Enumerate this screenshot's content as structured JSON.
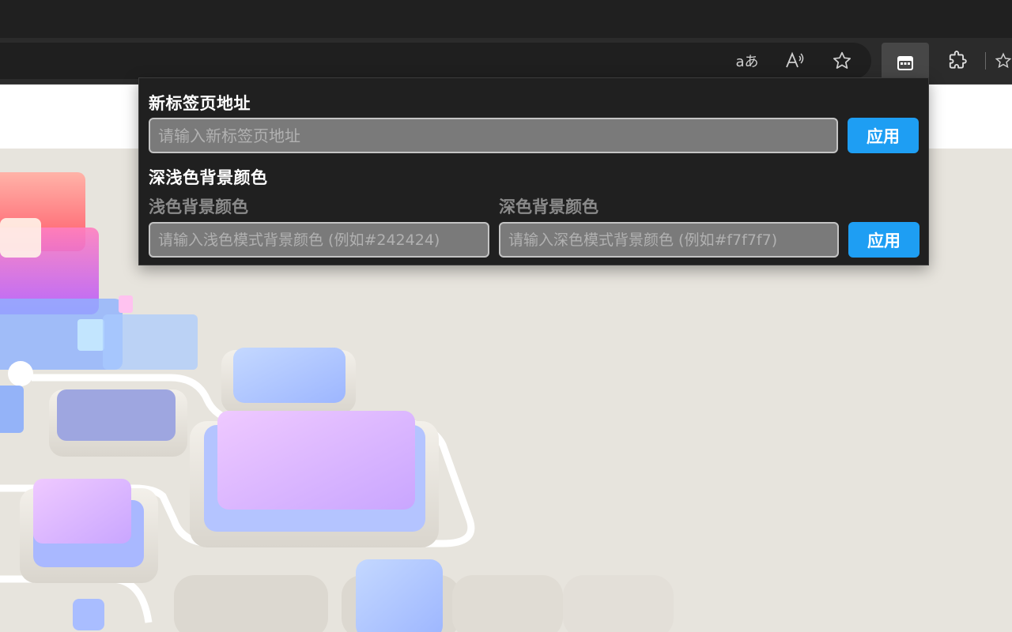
{
  "toolbar": {
    "read_aloud_glyph": "aあ",
    "icons": [
      "translate-icon",
      "read-aloud-icon",
      "favorite-star-icon",
      "extension-popup-icon",
      "extensions-puzzle-icon",
      "favorites-bar-icon"
    ]
  },
  "popup": {
    "newtab_section_title": "新标签页地址",
    "newtab_placeholder": "请输入新标签页地址",
    "apply_label": "应用",
    "bg_section_title": "深浅色背景颜色",
    "light_label": "浅色背景颜色",
    "light_placeholder": "请输入浅色模式背景颜色 (例如#242424)",
    "dark_label": "深色背景颜色",
    "dark_placeholder": "请输入深色模式背景颜色 (例如#f7f7f7)",
    "apply_label_2": "应用"
  },
  "colors": {
    "accent_button": "#1e9ef3",
    "popup_bg": "#202020",
    "input_bg": "#7a7a7a"
  }
}
